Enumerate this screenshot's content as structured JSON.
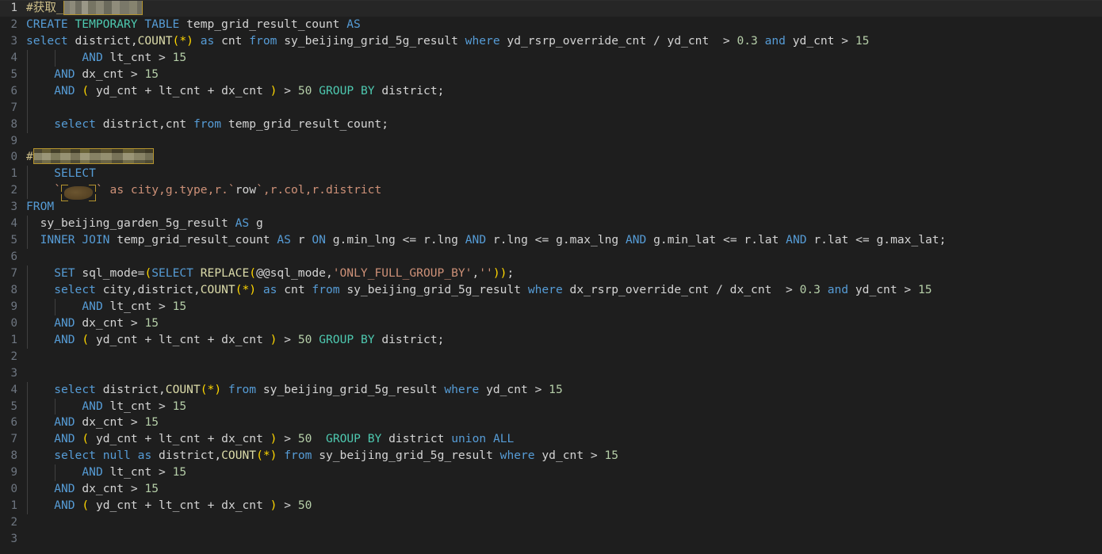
{
  "editor": {
    "language": "sql",
    "theme": "dark-plus",
    "background": "#1e1e1e",
    "active_line_background": "#262626",
    "gutter_color": "#6e7681",
    "colors": {
      "keyword": "#569cd6",
      "keyword_secondary": "#4ec9b0",
      "function": "#dcdcaa",
      "number": "#b5cea8",
      "string": "#ce9178",
      "identifier": "#d4d4d4",
      "paren": "#ffd700",
      "redaction_border": "#b5942e"
    },
    "active_line": 1,
    "total_visible_lines": 43
  },
  "lines": [
    {
      "n": "1",
      "active": true,
      "indent_guides": 0,
      "text": "#获取_",
      "redaction": "mosaic-a"
    },
    {
      "n": "2",
      "active": false,
      "indent_guides": 0,
      "text": "CREATE TEMPORARY TABLE temp_grid_result_count AS"
    },
    {
      "n": "3",
      "active": false,
      "indent_guides": 0,
      "text": "select district,COUNT(*) as cnt from sy_beijing_grid_5g_result where yd_rsrp_override_cnt / yd_cnt  > 0.3 and yd_cnt > 15"
    },
    {
      "n": "4",
      "active": false,
      "indent_guides": 2,
      "text": "        AND lt_cnt > 15"
    },
    {
      "n": "5",
      "active": false,
      "indent_guides": 1,
      "text": "    AND dx_cnt > 15"
    },
    {
      "n": "6",
      "active": false,
      "indent_guides": 1,
      "text": "    AND ( yd_cnt + lt_cnt + dx_cnt ) > 50 GROUP BY district;"
    },
    {
      "n": "7",
      "active": false,
      "indent_guides": 1,
      "text": ""
    },
    {
      "n": "8",
      "active": false,
      "indent_guides": 1,
      "text": "    select district,cnt from temp_grid_result_count;"
    },
    {
      "n": "9",
      "active": false,
      "indent_guides": 0,
      "text": ""
    },
    {
      "n": "0",
      "active": false,
      "indent_guides": 0,
      "text": "#",
      "redaction": "mosaic-b"
    },
    {
      "n": "1",
      "active": false,
      "indent_guides": 1,
      "text": "    SELECT"
    },
    {
      "n": "2",
      "active": false,
      "indent_guides": 1,
      "text": "    `",
      "redaction": "smudge",
      "text_after": "` as city,g.type,r.`row`,r.col,r.district"
    },
    {
      "n": "3",
      "active": false,
      "indent_guides": 0,
      "text": "FROM"
    },
    {
      "n": "4",
      "active": false,
      "indent_guides": 1,
      "text": "  sy_beijing_garden_5g_result AS g"
    },
    {
      "n": "5",
      "active": false,
      "indent_guides": 1,
      "text": "  INNER JOIN temp_grid_result_count AS r ON g.min_lng <= r.lng AND r.lng <= g.max_lng AND g.min_lat <= r.lat AND r.lat <= g.max_lat;"
    },
    {
      "n": "6",
      "active": false,
      "indent_guides": 0,
      "text": ""
    },
    {
      "n": "7",
      "active": false,
      "indent_guides": 1,
      "text": "    SET sql_mode=(SELECT REPLACE(@@sql_mode,'ONLY_FULL_GROUP_BY',''));"
    },
    {
      "n": "8",
      "active": false,
      "indent_guides": 1,
      "text": "    select city,district,COUNT(*) as cnt from sy_beijing_grid_5g_result where dx_rsrp_override_cnt / dx_cnt  > 0.3 and yd_cnt > 15"
    },
    {
      "n": "9",
      "active": false,
      "indent_guides": 2,
      "text": "        AND lt_cnt > 15"
    },
    {
      "n": "0",
      "active": false,
      "indent_guides": 1,
      "text": "    AND dx_cnt > 15"
    },
    {
      "n": "1",
      "active": false,
      "indent_guides": 1,
      "text": "    AND ( yd_cnt + lt_cnt + dx_cnt ) > 50 GROUP BY district;"
    },
    {
      "n": "2",
      "active": false,
      "indent_guides": 0,
      "text": ""
    },
    {
      "n": "3",
      "active": false,
      "indent_guides": 0,
      "text": ""
    },
    {
      "n": "4",
      "active": false,
      "indent_guides": 1,
      "text": "    select district,COUNT(*) from sy_beijing_grid_5g_result where yd_cnt > 15"
    },
    {
      "n": "5",
      "active": false,
      "indent_guides": 2,
      "text": "        AND lt_cnt > 15"
    },
    {
      "n": "6",
      "active": false,
      "indent_guides": 1,
      "text": "    AND dx_cnt > 15"
    },
    {
      "n": "7",
      "active": false,
      "indent_guides": 1,
      "text": "    AND ( yd_cnt + lt_cnt + dx_cnt ) > 50  GROUP BY district union ALL"
    },
    {
      "n": "8",
      "active": false,
      "indent_guides": 1,
      "text": "    select null as district,COUNT(*) from sy_beijing_grid_5g_result where yd_cnt > 15"
    },
    {
      "n": "9",
      "active": false,
      "indent_guides": 2,
      "text": "        AND lt_cnt > 15"
    },
    {
      "n": "0",
      "active": false,
      "indent_guides": 1,
      "text": "    AND dx_cnt > 15"
    },
    {
      "n": "1",
      "active": false,
      "indent_guides": 1,
      "text": "    AND ( yd_cnt + lt_cnt + dx_cnt ) > 50"
    },
    {
      "n": "2",
      "active": false,
      "indent_guides": 0,
      "text": ""
    },
    {
      "n": "3",
      "active": false,
      "indent_guides": 0,
      "text": ""
    }
  ]
}
